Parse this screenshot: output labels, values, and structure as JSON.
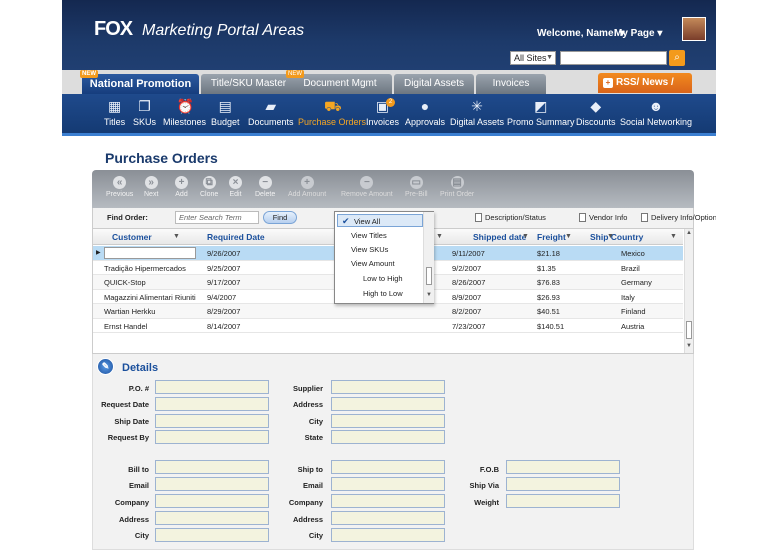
{
  "header": {
    "logo": "FOX",
    "title": "Marketing Portal Areas",
    "welcome": "Welcome, Name! ▾",
    "my_page": "My Page ▾",
    "site_select": "All Sites",
    "search_value": ""
  },
  "tabs": [
    {
      "label": "National Promotion",
      "new": "NEW"
    },
    {
      "label": "Title/SKU Master",
      "new": ""
    },
    {
      "label": "Document Mgmt",
      "new": "NEW"
    },
    {
      "label": "Digital Assets",
      "new": ""
    },
    {
      "label": "Invoices",
      "new": ""
    }
  ],
  "rss_label": "RSS/ News / Links",
  "nav": [
    "Titles",
    "SKUs",
    "Milestones",
    "Budget",
    "Documents",
    "Purchase Orders",
    "Invoices",
    "Approvals",
    "Digital Assets",
    "Promo Summary",
    "Discounts",
    "Social Networking"
  ],
  "nav_badge": "2",
  "page_title": "Purchase Orders",
  "toolbar": [
    "Previous",
    "Next",
    "Add",
    "Clone",
    "Edit",
    "Delete",
    "Add Amount",
    "Remove Amount",
    "Pre-Bill",
    "Print Order"
  ],
  "find": {
    "label": "Find Order:",
    "placeholder": "Enter Search Term",
    "button": "Find"
  },
  "filter_links": [
    "Description/Status",
    "Vendor Info",
    "Delivery Info/Options"
  ],
  "grid": {
    "columns": [
      "Customer",
      "Required Date",
      "Shipped date",
      "Freight",
      "Ship Country"
    ],
    "rows": [
      [
        "",
        "9/26/2007",
        "9/11/2007",
        "$21.18",
        "Mexico"
      ],
      [
        "Tradição Hipermercados",
        "9/25/2007",
        "9/2/2007",
        "$1.35",
        "Brazil"
      ],
      [
        "QUICK-Stop",
        "9/17/2007",
        "8/26/2007",
        "$76.83",
        "Germany"
      ],
      [
        "Magazzini Alimentari Riuniti",
        "9/4/2007",
        "8/9/2007",
        "$26.93",
        "Italy"
      ],
      [
        "Wartian Herkku",
        "8/29/2007",
        "8/2/2007",
        "$40.51",
        "Finland"
      ],
      [
        "Ernst Handel",
        "8/14/2007",
        "7/23/2007",
        "$140.51",
        "Austria"
      ]
    ]
  },
  "dropdown": [
    "View All",
    "View Titles",
    "View SKUs",
    "View Amount",
    "Low to High",
    "High to Low"
  ],
  "details": {
    "title": "Details",
    "col1": [
      "P.O. #",
      "Request Date",
      "Ship Date",
      "Request By"
    ],
    "col2": [
      "Supplier",
      "Address",
      "City",
      "State"
    ],
    "col3": [
      "Bill to",
      "Email",
      "Company",
      "Address",
      "City"
    ],
    "col4": [
      "Ship to",
      "Email",
      "Company",
      "Address",
      "City"
    ],
    "col5": [
      "F.O.B",
      "Ship Via",
      "Weight"
    ]
  },
  "colors": {
    "accent": "#f39a1c",
    "nav": "#1f4a8c",
    "header": "#1d3a6a",
    "selected_row": "#b9dbf4"
  }
}
